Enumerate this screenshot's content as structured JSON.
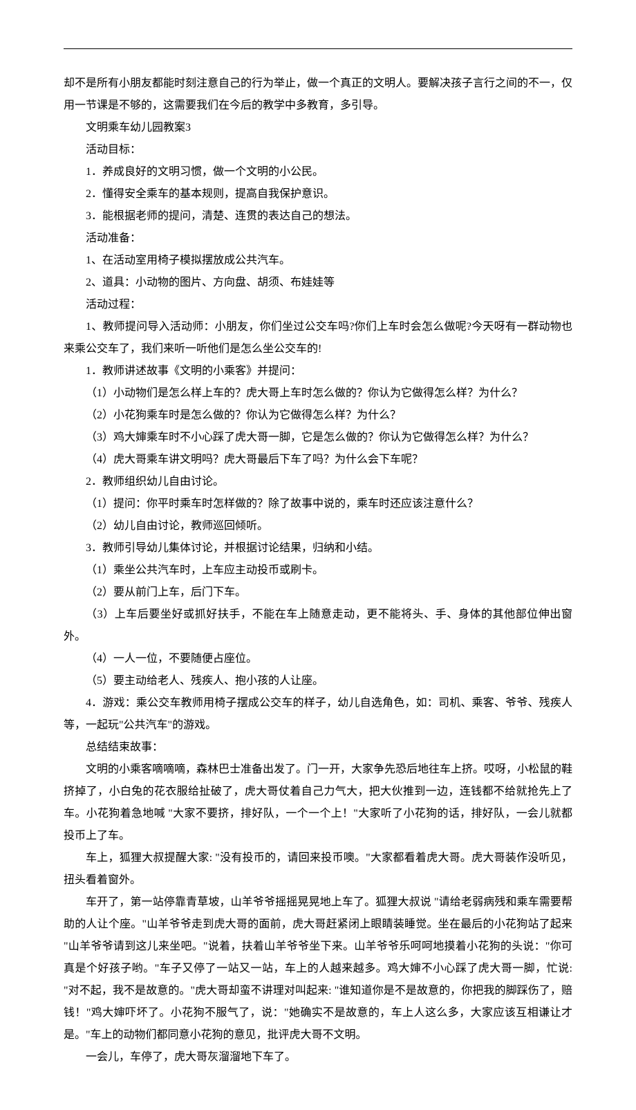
{
  "lines": [
    {
      "cls": "para-noindent",
      "text": "却不是所有小朋友都能时刻注意自己的行为举止，做一个真正的文明人。要解决孩子言行之间的不一，仅用一节课是不够的，这需要我们在今后的教学中多教育，多引导。"
    },
    {
      "cls": "para",
      "text": "文明乘车幼儿园教案3"
    },
    {
      "cls": "para",
      "text": "活动目标："
    },
    {
      "cls": "para",
      "text": "1．养成良好的文明习惯，做一个文明的小公民。"
    },
    {
      "cls": "para",
      "text": "2．懂得安全乘车的基本规则，提高自我保护意识。"
    },
    {
      "cls": "para",
      "text": "3．能根据老师的提问，清楚、连贯的表达自己的想法。"
    },
    {
      "cls": "para",
      "text": "活动准备："
    },
    {
      "cls": "para",
      "text": "1、在活动室用椅子模拟摆放成公共汽车。"
    },
    {
      "cls": "para",
      "text": "2、道具：小动物的图片、方向盘、胡须、布娃娃等"
    },
    {
      "cls": "para",
      "text": "活动过程："
    },
    {
      "cls": "para",
      "text": "1、教师提问导入活动师：小朋友，你们坐过公交车吗?你们上车时会怎么做呢?今天呀有一群动物也来乘公交车了，我们来听一听他们是怎么坐公交车的!"
    },
    {
      "cls": "para",
      "text": "1．教师讲述故事《文明的小乘客》并提问："
    },
    {
      "cls": "para",
      "text": "（1）小动物们是怎么样上车的？虎大哥上车时怎么做的？你认为它做得怎么样？为什么？"
    },
    {
      "cls": "para",
      "text": "（2）小花狗乘车时是怎么做的？你认为它做得怎么样？为什么？"
    },
    {
      "cls": "para",
      "text": "（3）鸡大婶乘车时不小心踩了虎大哥一脚，它是怎么做的？你认为它做得怎么样？为什么？"
    },
    {
      "cls": "para",
      "text": "（4）虎大哥乘车讲文明吗？虎大哥最后下车了吗？为什么会下车呢？"
    },
    {
      "cls": "para",
      "text": "2．教师组织幼儿自由讨论。"
    },
    {
      "cls": "para",
      "text": "（1）提问：你平时乘车时怎样做的？除了故事中说的，乘车时还应该注意什么？"
    },
    {
      "cls": "para",
      "text": "（2）幼儿自由讨论，教师巡回倾听。"
    },
    {
      "cls": "para",
      "text": "3．教师引导幼儿集体讨论，并根据讨论结果，归纳和小结。"
    },
    {
      "cls": "para",
      "text": "（1）乘坐公共汽车时，上车应主动投币或刷卡。"
    },
    {
      "cls": "para",
      "text": "（2）要从前门上车，后门下车。"
    },
    {
      "cls": "para",
      "text": "（3）上车后要坐好或抓好扶手，不能在车上随意走动，更不能将头、手、身体的其他部位伸出窗外。"
    },
    {
      "cls": "para",
      "text": "（4）一人一位，不要随便占座位。"
    },
    {
      "cls": "para",
      "text": "（5）要主动给老人、残疾人、抱小孩的人让座。"
    },
    {
      "cls": "para",
      "text": "4．游戏：乘公交车教师用椅子摆成公交车的样子，幼儿自选角色，如：司机、乘客、爷爷、残疾人等，一起玩\"公共汽车\"的游戏。"
    },
    {
      "cls": "para",
      "text": "总结结束故事："
    },
    {
      "cls": "para",
      "text": "文明的小乘客嘀嘀嘀，森林巴士准备出发了。门一开，大家争先恐后地往车上挤。哎呀，小松鼠的鞋挤掉了，小白兔的花衣服给扯破了，虎大哥仗着自己力气大，把大伙推到一边，连钱都不给就抢先上了车。小花狗着急地喊 \"大家不要挤，排好队，一个一个上！\"大家听了小花狗的话，排好队，一会儿就都投币上了车。"
    },
    {
      "cls": "para",
      "text": "车上，狐狸大叔提醒大家: \"没有投币的，请回来投币噢。\"大家都看着虎大哥。虎大哥装作没听见，扭头看着窗外。"
    },
    {
      "cls": "para",
      "text": "车开了，第一站停靠青草坡，山羊爷爷摇摇晃晃地上车了。狐狸大叔说 \"请给老弱病残和乘车需要帮助的人让个座。\"山羊爷爷走到虎大哥的面前，虎大哥赶紧闭上眼睛装睡觉。坐在最后的小花狗站了起来 \"山羊爷爷请到这儿来坐吧。\"说着，扶着山羊爷爷坐下来。山羊爷爷乐呵呵地摸着小花狗的头说：\"你可真是个好孩子哟。\"车子又停了一站又一站，车上的人越来越多。鸡大婶不小心踩了虎大哥一脚，忙说: \"对不起，我不是故意的。\"虎大哥却蛮不讲理对叫起来: \"谁知道你是不是故意的，你把我的脚踩伤了，赔钱！\"鸡大婶吓坏了。小花狗不服气了，说：\"她确实不是故意的，车上人这么多，大家应该互相谦让才是。\"车上的动物们都同意小花狗的意见，批评虎大哥不文明。"
    },
    {
      "cls": "para",
      "text": "一会儿，车停了，虎大哥灰溜溜地下车了。"
    }
  ]
}
